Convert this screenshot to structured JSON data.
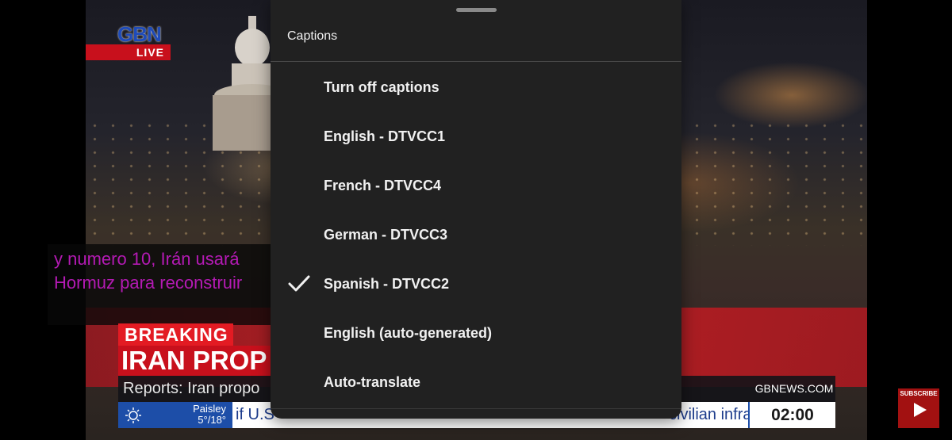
{
  "video": {
    "logo_text": "GBN",
    "live_label": "LIVE",
    "captions": [
      "y numero 10, Irán usará",
      "Hormuz para reconstruir"
    ],
    "breaking_label": "BREAKING",
    "headline": "IRAN PROP",
    "subheadline": "Reports: Iran propo",
    "channel_url": "GBNEWS.COM",
    "weather": {
      "city": "Paisley",
      "temp": "5°/18°"
    },
    "ticker_text": "if U.S",
    "ticker_right_text": "civilian infra",
    "clock": "02:00",
    "subscribe_label": "SUBSCRIBE",
    "colors": {
      "brand_red": "#c8101c",
      "brand_blue": "#1d4ea8",
      "caption_magenta": "#b41ab4"
    }
  },
  "captions_menu": {
    "title": "Captions",
    "selected_index": 4,
    "items": [
      {
        "label": "Turn off captions"
      },
      {
        "label": "English - DTVCC1"
      },
      {
        "label": "French - DTVCC4"
      },
      {
        "label": "German - DTVCC3"
      },
      {
        "label": "Spanish - DTVCC2"
      },
      {
        "label": "English (auto-generated)"
      },
      {
        "label": "Auto-translate"
      }
    ],
    "check_icon": "check-icon"
  }
}
